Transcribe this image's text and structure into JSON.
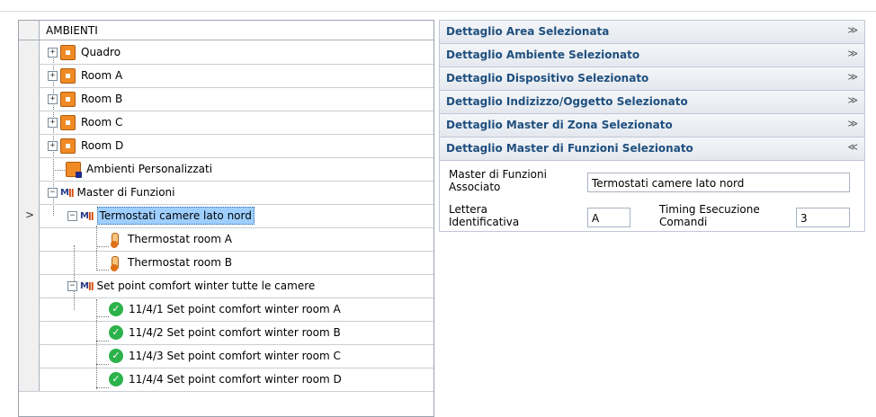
{
  "tree": {
    "header": "AMBIENTI",
    "items": [
      {
        "label": "Quadro"
      },
      {
        "label": "Room A"
      },
      {
        "label": "Room B"
      },
      {
        "label": "Room C"
      },
      {
        "label": "Room D"
      },
      {
        "label": "Ambienti Personalizzati"
      },
      {
        "label": "Master di Funzioni"
      },
      {
        "label": "Termostati camere lato nord"
      },
      {
        "label": "Thermostat room A"
      },
      {
        "label": "Thermostat room B"
      },
      {
        "label": "Set point comfort winter tutte le camere"
      },
      {
        "label": "11/4/1 Set point comfort winter room A"
      },
      {
        "label": "11/4/2 Set point comfort winter room B"
      },
      {
        "label": "11/4/3 Set point comfort winter room C"
      },
      {
        "label": "11/4/4 Set point comfort winter room D"
      }
    ],
    "selected_row_marker": ">"
  },
  "accordion": {
    "sections": [
      {
        "title": "Dettaglio Area Selezionata",
        "chevron": "≫"
      },
      {
        "title": "Dettaglio Ambiente Selezionato",
        "chevron": "≫"
      },
      {
        "title": "Dettaglio Dispositivo Selezionato",
        "chevron": "≫"
      },
      {
        "title": "Dettaglio Indizizzo/Oggetto Selezionato",
        "chevron": "≫"
      },
      {
        "title": "Dettaglio Master di Zona Selezionato",
        "chevron": "≫"
      },
      {
        "title": "Dettaglio Master di Funzioni Selezionato",
        "chevron": "≪"
      }
    ]
  },
  "detail": {
    "master_label_1": "Master di Funzioni",
    "master_label_2": "Associato",
    "master_value": "Termostati camere lato nord",
    "lettera_label_1": "Lettera",
    "lettera_label_2": "Identificativa",
    "lettera_value": "A",
    "timing_label_1": "Timing Esecuzione",
    "timing_label_2": "Comandi",
    "timing_value": "3"
  },
  "colors": {
    "accent_title": "#1e4f7e",
    "selection": "#9ecfff",
    "room_icon": "#f08a24",
    "check_icon": "#2bb24a"
  }
}
